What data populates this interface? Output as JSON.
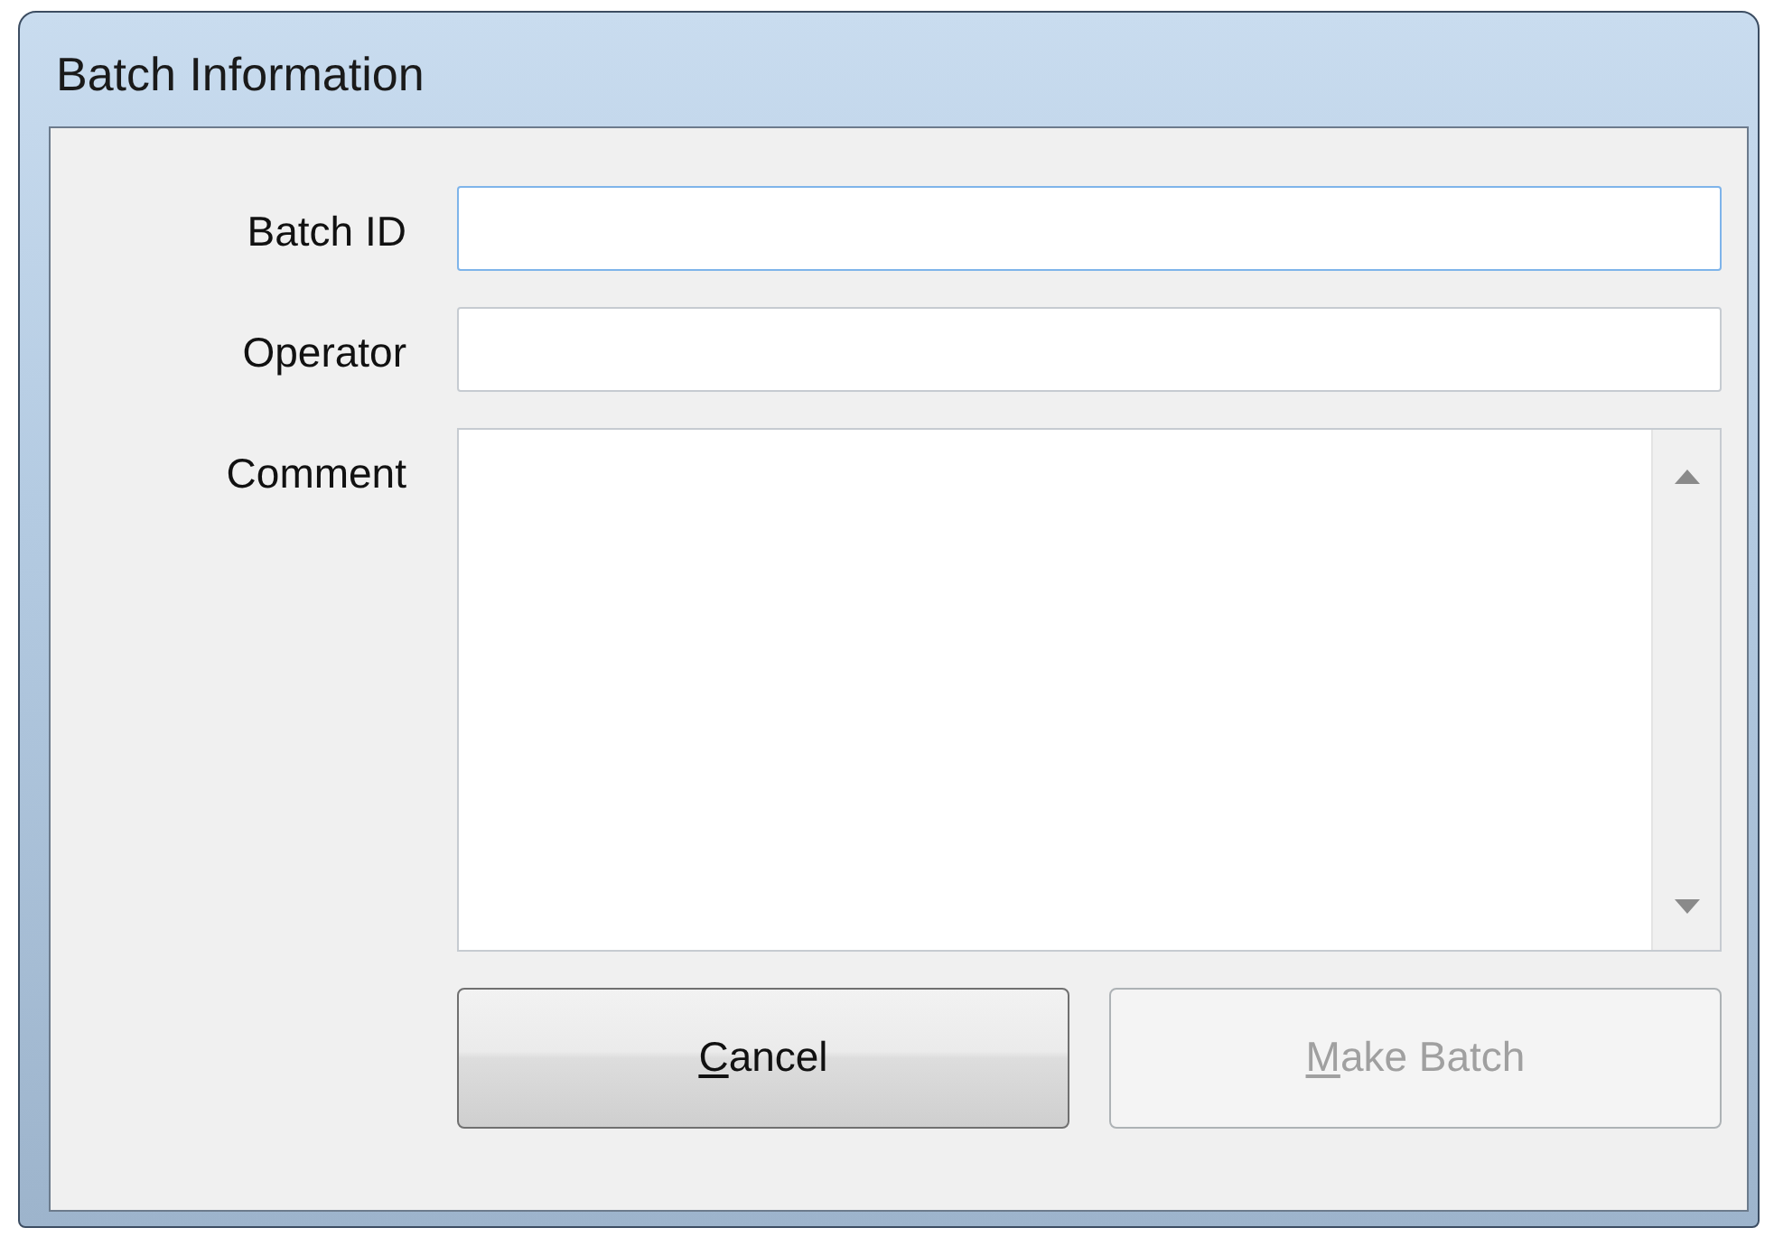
{
  "window": {
    "title": "Batch Information"
  },
  "fields": [
    {
      "label": "Batch ID",
      "kind": "text",
      "focused": true
    },
    {
      "label": "Operator",
      "kind": "text",
      "focused": false
    },
    {
      "label": "Comment",
      "kind": "multiline",
      "focused": false
    }
  ],
  "buttons": [
    {
      "label": "Cancel",
      "underline_first": true,
      "disabled": false
    },
    {
      "label": "Make Batch",
      "underline_first": true,
      "disabled": true
    }
  ]
}
